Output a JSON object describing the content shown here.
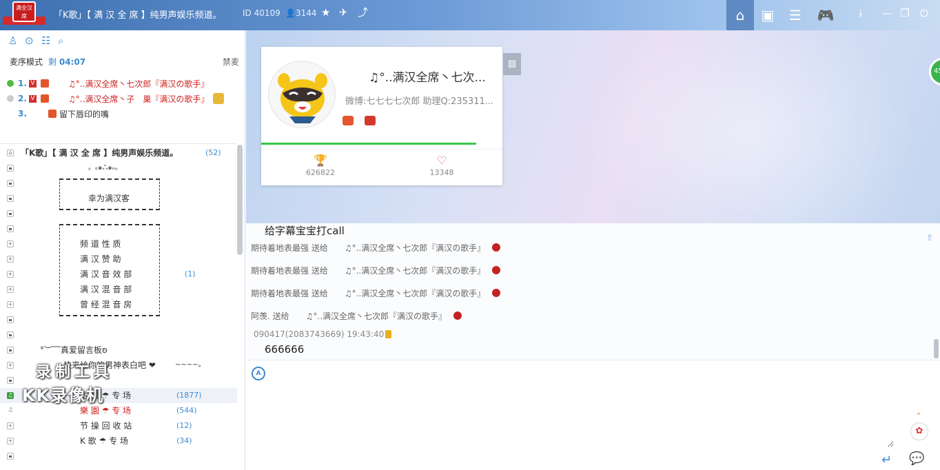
{
  "titlebar": {
    "channel_title": "「K歌」【 满 汉 全 席 】纯男声娱乐频道。",
    "channel_id": "ID 40109",
    "online_count": "3144",
    "logo_text": "满全汉席"
  },
  "nav": {
    "icons": [
      "home-icon",
      "profile-card-icon",
      "list-icon",
      "game-icon",
      "download-icon",
      "minimize-icon",
      "maximize-icon",
      "power-icon"
    ]
  },
  "left": {
    "mic_mode_label": "麦序模式",
    "mic_time_prefix": "剩",
    "mic_time": "04:07",
    "ban_label": "禁麦",
    "queue": [
      {
        "num": "1.",
        "name": "♫°..满汉全席丶七次郎『满汉の歌手』"
      },
      {
        "num": "2.",
        "name": "♫°..满汉全席丶子　巢『满汉の歌手』"
      },
      {
        "num": "3.",
        "name": "留下唇印的嘴"
      }
    ],
    "tree": {
      "root": "「K歌」【 满 汉 全 席 】纯男声娱乐频道。",
      "root_count": "(52)",
      "deco": "。ₒ๑ஃ๑ₒ。",
      "welcome": "幸为满汉客",
      "menu": [
        "频 道 性 质",
        "满 汉 赞 助",
        "满 汉 音 效 部",
        "满 汉 混 音 部",
        "曾 经 混 音 房"
      ],
      "menu_count": "(1)",
      "board": "°︶‾‾真爱留言板ʚ",
      "board2": "快来给你的男神表白吧 ❤",
      "board_deco": "~~~~。",
      "rooms": [
        {
          "name": "古 风 ☂ 专 场",
          "count": "(1877)"
        },
        {
          "name": "樂 園 ☂ 专 场",
          "count": "(544)"
        },
        {
          "name": "节 操 回 收 站",
          "count": "(12)"
        },
        {
          "name": "K 歌 ☂ 专 场",
          "count": "(34)"
        }
      ]
    },
    "watermark_line1": "录制工具",
    "watermark_line2": "KK录像机"
  },
  "card": {
    "name": "♫°..满汉全席丶七次...",
    "sub": "微博:七七七七次郎  助理Q:235311...",
    "stat1_value": "626822",
    "stat2_value": "13348",
    "progress": 0.89
  },
  "stage": {
    "side_badge": "45"
  },
  "chat": {
    "first_message": "给字幕宝宝打call",
    "gifts": [
      {
        "sender": "期待着地表最强",
        "verb": "送给",
        "receiver": "♫°..满汉全席丶七次郎『满汉の歌手』"
      },
      {
        "sender": "期待着地表最强",
        "verb": "送给",
        "receiver": "♫°..满汉全席丶七次郎『满汉の歌手』"
      },
      {
        "sender": "期待着地表最强",
        "verb": "送给",
        "receiver": "♫°..满汉全席丶七次郎『满汉の歌手』"
      },
      {
        "sender": "阿羡.",
        "verb": "送给",
        "receiver": "♫°..满汉全席丶七次郎『满汉の歌手』"
      }
    ],
    "last_meta": "090417(2083743669) 19:43:40",
    "last_message": "666666"
  },
  "input": {
    "font_label": "A"
  },
  "colors": {
    "accent": "#3c8ad2",
    "mic_name_red": "#d02020",
    "progress_green": "#35c84a"
  }
}
